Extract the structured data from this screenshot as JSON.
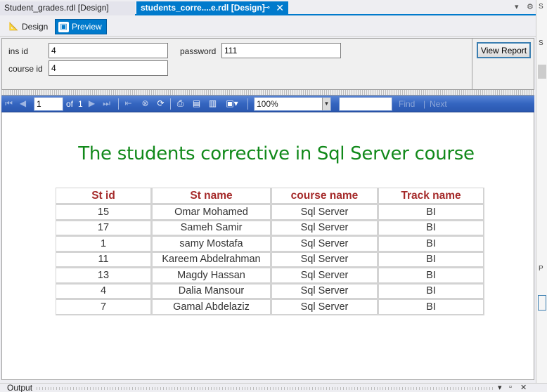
{
  "tabs": [
    {
      "label": "Student_grades.rdl [Design]",
      "active": false
    },
    {
      "label": "students_corre....e.rdl [Design]",
      "active": true
    }
  ],
  "mode_toolbar": {
    "design_label": "Design",
    "preview_label": "Preview"
  },
  "parameters": {
    "ins_id": {
      "label": "ins id",
      "value": "4"
    },
    "password": {
      "label": "password",
      "value": "111"
    },
    "course_id": {
      "label": "course id",
      "value": "4"
    },
    "view_report_label": "View Report"
  },
  "viewer_toolbar": {
    "current_page": "1",
    "of_label": "of",
    "total_pages": "1",
    "zoom": "100%",
    "find_label": "Find",
    "find_separator": "|",
    "next_label": "Next"
  },
  "report": {
    "title": "The students corrective in Sql Server course",
    "columns": [
      "St id",
      "St name",
      "course name",
      "Track name"
    ],
    "rows": [
      [
        "15",
        "Omar Mohamed",
        "Sql Server",
        "BI"
      ],
      [
        "17",
        "Sameh Samir",
        "Sql Server",
        "BI"
      ],
      [
        "1",
        "samy Mostafa",
        "Sql Server",
        "BI"
      ],
      [
        "11",
        "Kareem Abdelrahman",
        "Sql Server",
        "BI"
      ],
      [
        "13",
        "Magdy Hassan",
        "Sql Server",
        "BI"
      ],
      [
        "4",
        "Dalia Mansour",
        "Sql Server",
        "BI"
      ],
      [
        "7",
        "Gamal Abdelaziz",
        "Sql Server",
        "BI"
      ]
    ]
  },
  "output_panel": {
    "label": "Output"
  },
  "colors": {
    "accent": "#007acc",
    "title_green": "#11891a",
    "header_brown": "#a52a2a",
    "toolbar_blue": "#3465c0"
  }
}
